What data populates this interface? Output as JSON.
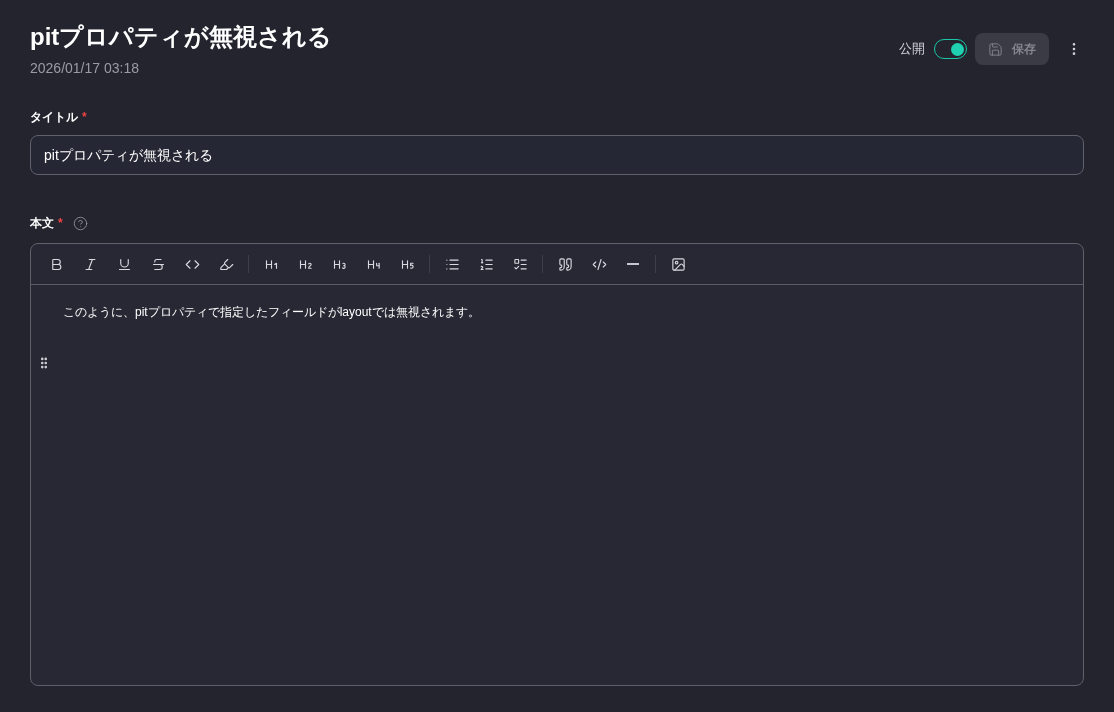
{
  "page": {
    "title": "pitプロパティが無視される",
    "timestamp": "2026/01/17 03:18"
  },
  "header_actions": {
    "public_toggle": {
      "label": "公開",
      "on": true
    },
    "save_button": {
      "label": "保存",
      "disabled": true
    }
  },
  "title_field": {
    "label": "タイトル",
    "required_mark": "*",
    "value": "pitプロパティが無視される"
  },
  "body_field": {
    "label": "本文",
    "required_mark": "*",
    "paragraphs": [
      "このように、pitプロパティで指定したフィールドがlayoutでは無視されます。"
    ]
  }
}
